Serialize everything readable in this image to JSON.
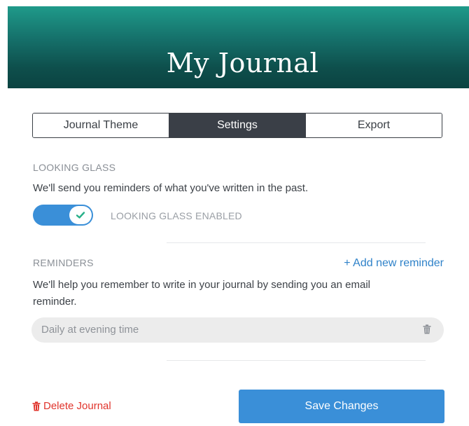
{
  "header": {
    "title": "My Journal"
  },
  "tabs": [
    {
      "label": "Journal Theme",
      "active": false
    },
    {
      "label": "Settings",
      "active": true
    },
    {
      "label": "Export",
      "active": false
    }
  ],
  "looking_glass": {
    "section_label": "LOOKING GLASS",
    "description": "We'll send you reminders of what you've written in the past.",
    "toggle_enabled": true,
    "toggle_label": "LOOKING GLASS ENABLED"
  },
  "reminders": {
    "section_label": "REMINDERS",
    "add_label": "+ Add new reminder",
    "description_line1": "We'll help you remember to write in your journal by sending you an email",
    "description_line2": "reminder.",
    "items": [
      {
        "label": "Daily at evening time"
      }
    ]
  },
  "footer": {
    "delete_label": "Delete Journal",
    "save_label": "Save Changes"
  },
  "colors": {
    "accent_blue": "#3a8fd8",
    "link_blue": "#2f82c9",
    "danger_red": "#e0342c",
    "header_teal": "#15706a",
    "check_green": "#27b089",
    "tab_active_bg": "#3a3f47"
  },
  "icons": {
    "toggle_check": "check-icon",
    "reminder_delete": "trash-icon",
    "journal_delete": "trash-icon"
  }
}
